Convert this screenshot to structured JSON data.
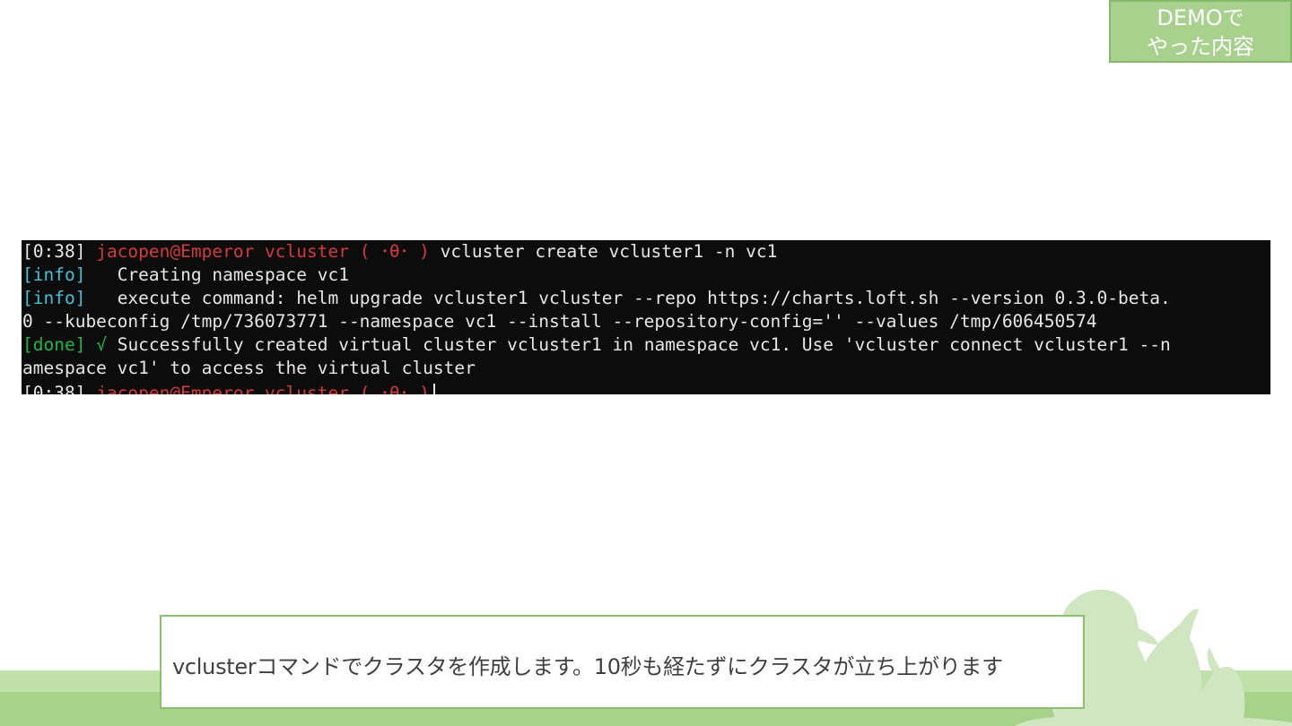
{
  "badge": {
    "line1": "DEMOで",
    "line2": "やった内容"
  },
  "terminal": {
    "prompt_time": "[0:38]",
    "prompt_user": "jacopen@Emperor vcluster ( ･θ･ )",
    "command": "vcluster create vcluster1 -n vc1",
    "info_tag": "[info]",
    "info1_text": "Creating namespace vc1",
    "info2_text": "execute command: helm upgrade vcluster1 vcluster --repo https://charts.loft.sh --version 0.3.0-beta.",
    "info2_wrap": "0 --kubeconfig /tmp/736073771 --namespace vc1 --install --repository-config='' --values /tmp/606450574",
    "done_tag": "[done]",
    "check": "√",
    "done_text": "Successfully created virtual cluster vcluster1 in namespace vc1. Use 'vcluster connect vcluster1 --n",
    "done_wrap": "amespace vc1' to access the virtual cluster",
    "colors": {
      "background": "#0c0c0c",
      "text": "#e6e6e6",
      "prompt": "#d53a3a",
      "info": "#45c0d6",
      "done": "#19b84b"
    }
  },
  "caption": {
    "text": "vclusterコマンドでクラスタを作成します。10秒も経たずにクラスタが立ち上がります"
  },
  "theme": {
    "accent": "#a9d18e",
    "band": "#a5d38a"
  }
}
